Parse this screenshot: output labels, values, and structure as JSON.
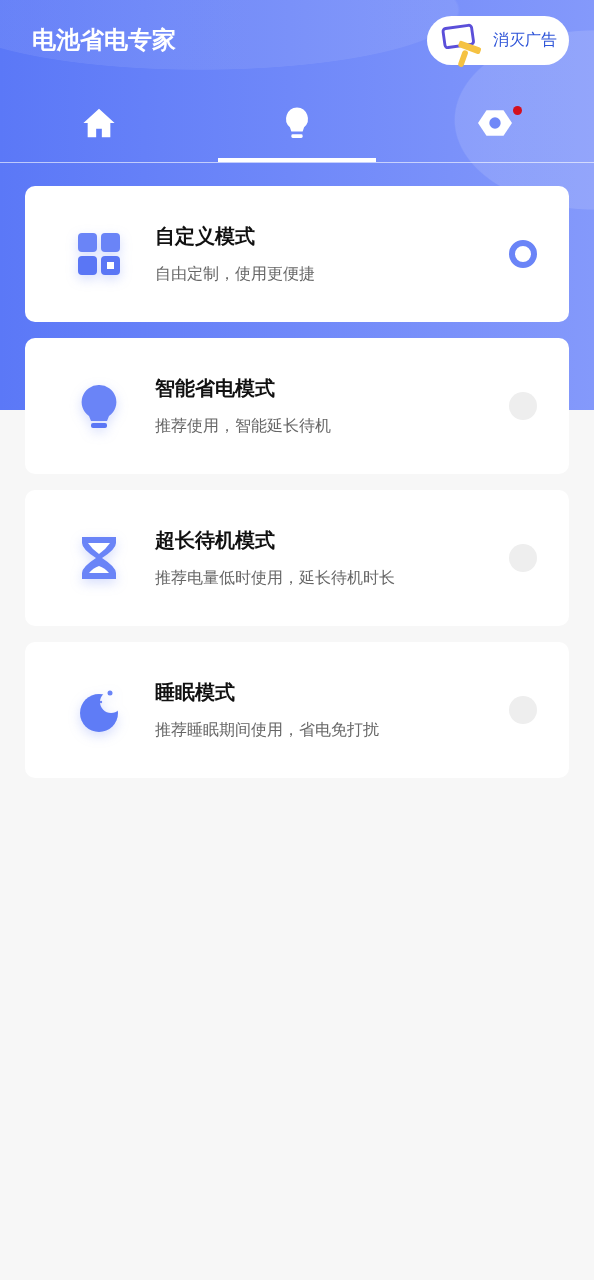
{
  "header": {
    "title": "电池省电专家",
    "ad_button": {
      "label": "消灭广告"
    }
  },
  "tabs": [
    {
      "kind": "home",
      "selected": false,
      "badge": false
    },
    {
      "kind": "bulb",
      "selected": true,
      "badge": false
    },
    {
      "kind": "settings",
      "selected": false,
      "badge": true
    }
  ],
  "modes": [
    {
      "kind": "grid",
      "title": "自定义模式",
      "subtitle": "自由定制，使用更便捷",
      "selected": true
    },
    {
      "kind": "bulb",
      "title": "智能省电模式",
      "subtitle": "推荐使用，智能延长待机",
      "selected": false
    },
    {
      "kind": "hourglass",
      "title": "超长待机模式",
      "subtitle": "推荐电量低时使用，延长待机时长",
      "selected": false
    },
    {
      "kind": "moon",
      "title": "睡眠模式",
      "subtitle": "推荐睡眠期间使用，省电免打扰",
      "selected": false
    }
  ]
}
